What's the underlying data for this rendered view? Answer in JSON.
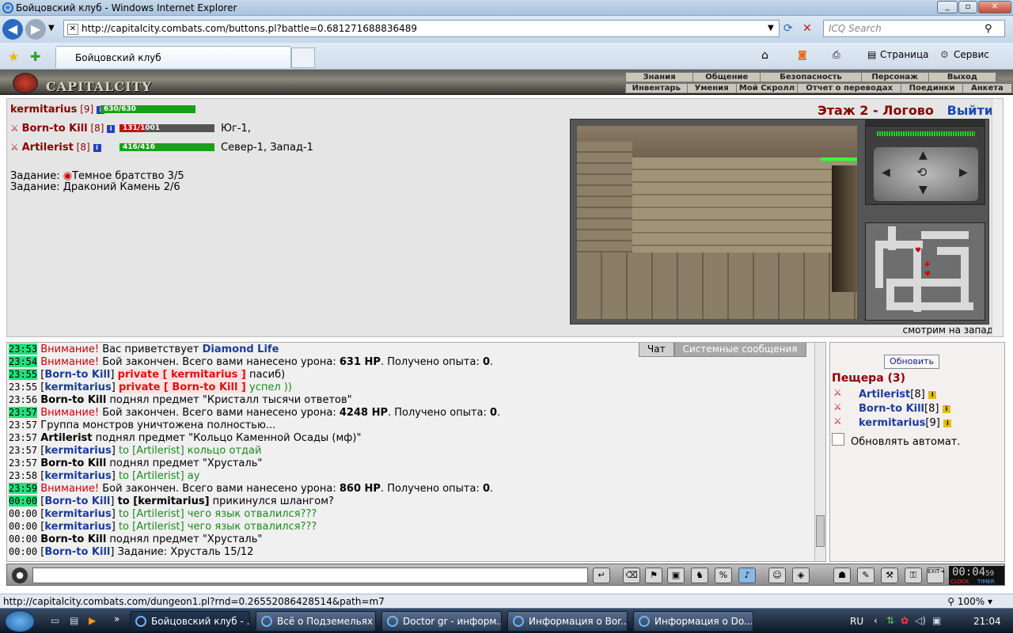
{
  "window": {
    "title": "Бойцовский клуб - Windows Internet Explorer"
  },
  "browser": {
    "url": "http://capitalcity.combats.com/buttons.pl?battle=0.681271688836489",
    "search_placeholder": "ICQ Search",
    "tab_title": "Бойцовский клуб",
    "page_menu": "Страница",
    "service_menu": "Сервис"
  },
  "game": {
    "logo": "CAPITALCITY",
    "menu_top": [
      "Знания",
      "Общение",
      "Безопасность",
      "Персонаж",
      "Выход"
    ],
    "menu_bottom": [
      "Инвентарь",
      "Умения",
      "Мой Скролл",
      "Отчет о переводах",
      "Поединки",
      "Анкета"
    ]
  },
  "party": {
    "self": {
      "name": "kermitarius",
      "level": "[9]",
      "hp": "630/630",
      "hp_fraction": 1.0
    },
    "members": [
      {
        "name": "Born-to Kill",
        "level": "[8]",
        "hp": "131/1001",
        "hp_fraction": 0.131,
        "location": "Юг-1,"
      },
      {
        "name": "Artilerist",
        "level": "[8]",
        "hp": "416/416",
        "hp_fraction": 1.0,
        "location": "Север-1, Запад-1"
      }
    ],
    "quests": [
      "Задание: ",
      "Темное братство 3/5",
      "Задание: Драконий Камень 2/6"
    ]
  },
  "location": {
    "title": "Этаж 2 - Логово",
    "exit": "Выйти",
    "looking": "смотрим на запад"
  },
  "chat": {
    "tabs": [
      "Чат",
      "Системные сообщения"
    ],
    "lines": [
      {
        "time": "23:53",
        "a": "Внимание!",
        "b": " Вас приветствует ",
        "c": "Diamond Life"
      },
      {
        "time": "23:54",
        "a": "Внимание!",
        "b": " Бой закончен. Всего вами нанесено урона: ",
        "c": "631 HP",
        "d": ". Получено опыта: ",
        "e": "0",
        "f": "."
      },
      {
        "time": "23:55",
        "a": "[",
        "b": "Born-to Kill",
        "c": "] ",
        "d": "private [ kermitarius ]",
        "e": " пасиб)"
      },
      {
        "time": "23:55",
        "a": "[",
        "b": "kermitarius",
        "c": "] ",
        "d": "private [ Born-to Kill ]",
        "e": " успел ))"
      },
      {
        "time": "23:56",
        "a": "Born-to Kill",
        "b": " поднял предмет \"Кристалл тысячи ответов\""
      },
      {
        "time": "23:57",
        "a": "Внимание!",
        "b": " Бой закончен. Всего вами нанесено урона: ",
        "c": "4248 HP",
        "d": ". Получено опыта: ",
        "e": "0",
        "f": "."
      },
      {
        "time": "23:57",
        "a": "Группа монстров уничтожена полностью..."
      },
      {
        "time": "23:57",
        "a": "Artilerist",
        "b": " поднял предмет \"Кольцо Каменной Осады (мф)\""
      },
      {
        "time": "23:57",
        "a": "[",
        "b": "kermitarius",
        "c": "] ",
        "d": "to [Artilerist] кольцо отдай"
      },
      {
        "time": "23:57",
        "a": "Born-to Kill",
        "b": " поднял предмет \"Хрусталь\""
      },
      {
        "time": "23:58",
        "a": "[",
        "b": "kermitarius",
        "c": "] ",
        "d": "to [Artilerist] ау"
      },
      {
        "time": "23:59",
        "a": "Внимание!",
        "b": " Бой закончен. Всего вами нанесено урона: ",
        "c": "860 HP",
        "d": ". Получено опыта: ",
        "e": "0",
        "f": "."
      },
      {
        "time": "00:00",
        "a": "[",
        "b": "Born-to Kill",
        "c": "] ",
        "d": "to [kermitarius]",
        "e": " прикинулся шлангом?"
      },
      {
        "time": "00:00",
        "a": "[",
        "b": "kermitarius",
        "c": "] ",
        "d": "to [Artilerist] чего язык отвалился???"
      },
      {
        "time": "00:00",
        "a": "[",
        "b": "kermitarius",
        "c": "] ",
        "d": "to [Artilerist] чего язык отвалился???"
      },
      {
        "time": "00:00",
        "a": "Born-to Kill",
        "b": " поднял предмет \"Хрусталь\""
      },
      {
        "time": "00:00",
        "a": "[",
        "b": "Born-to Kill",
        "c": "] ",
        "d": "Задание: Хрусталь 15/12"
      }
    ]
  },
  "cave": {
    "refresh": "Обновить",
    "title": "Пещера (3)",
    "members": [
      {
        "name": "Artilerist",
        "level": "[8]"
      },
      {
        "name": "Born-to Kill",
        "level": "[8]"
      },
      {
        "name": "kermitarius",
        "level": "[9]"
      }
    ],
    "auto_refresh": "Обновлять автомат."
  },
  "toolbar": {
    "clock": "00:04",
    "clock_sec": "59",
    "clock_label": "CLOCK",
    "timer_label": "TIMER",
    "exit_label": "EXIT"
  },
  "status": {
    "url": "http://capitalcity.combats.com/dungeon1.pl?rnd=0.26552086428514&path=m7",
    "zoom": "100%"
  },
  "taskbar": {
    "items": [
      "Бойцовский клуб - ...",
      "Всё о Подземельях ...",
      "Doctor gr - информ...",
      "Информация о Bor...",
      "Информация о Do..."
    ],
    "lang": "RU",
    "time": "21:04"
  },
  "colors": {
    "accent": "#8b0000",
    "hp": "#19a019",
    "nick": "#1c3c9c",
    "time_highlight": "#22e07b"
  }
}
